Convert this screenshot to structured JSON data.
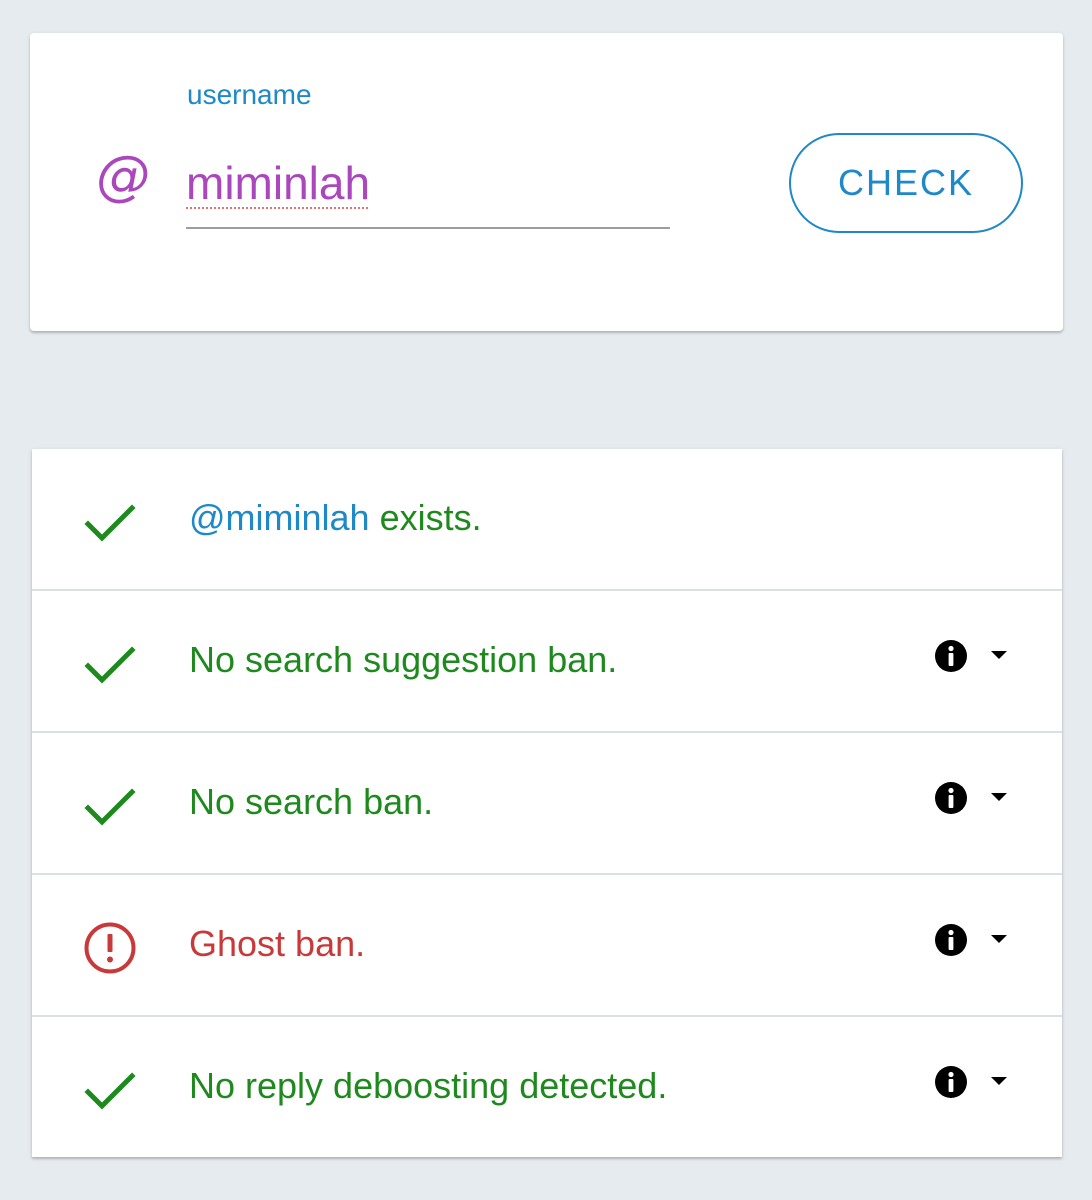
{
  "search": {
    "label": "username",
    "value": "miminlah",
    "at_icon": "@",
    "check_label": "CHECK"
  },
  "colors": {
    "accent_blue": "#1e88c9",
    "purple": "#ab47bc",
    "pass_green": "#1e8a1e",
    "fail_red": "#c83a3a",
    "background": "#e6ebf0"
  },
  "results": [
    {
      "status": "pass",
      "icon": "check-icon",
      "handle": "@miminlah",
      "text": " exists."
    },
    {
      "status": "pass",
      "icon": "check-icon",
      "text": "No search suggestion ban."
    },
    {
      "status": "pass",
      "icon": "check-icon",
      "text": "No search ban."
    },
    {
      "status": "fail",
      "icon": "alert-circle-icon",
      "text": "Ghost ban."
    },
    {
      "status": "pass",
      "icon": "check-icon",
      "text": "No reply deboosting detected."
    }
  ],
  "row_actions": {
    "info_icon": "info-icon",
    "expand_icon": "caret-down-icon"
  }
}
